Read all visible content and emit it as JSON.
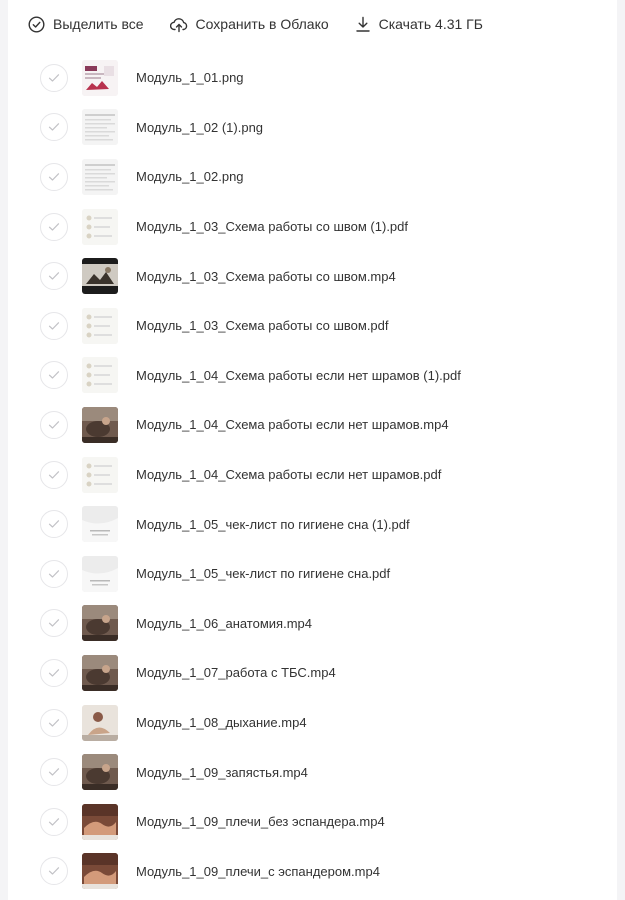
{
  "toolbar": {
    "select_all_label": "Выделить все",
    "save_cloud_label": "Сохранить в Облако",
    "download_label": "Скачать 4.31 ГБ"
  },
  "files": [
    {
      "name": "Модуль_1_01.png",
      "thumb": "slide"
    },
    {
      "name": "Модуль_1_02 (1).png",
      "thumb": "doc"
    },
    {
      "name": "Модуль_1_02.png",
      "thumb": "doc"
    },
    {
      "name": "Модуль_1_03_Схема работы со швом (1).pdf",
      "thumb": "pdf"
    },
    {
      "name": "Модуль_1_03_Схема работы со швом.mp4",
      "thumb": "video-dark"
    },
    {
      "name": "Модуль_1_03_Схема работы со швом.pdf",
      "thumb": "pdf"
    },
    {
      "name": "Модуль_1_04_Схема работы если нет шрамов (1).pdf",
      "thumb": "pdf"
    },
    {
      "name": "Модуль_1_04_Схема работы если нет шрамов.mp4",
      "thumb": "video"
    },
    {
      "name": "Модуль_1_04_Схема работы если нет шрамов.pdf",
      "thumb": "pdf"
    },
    {
      "name": "Модуль_1_05_чек-лист по гигиене сна (1).pdf",
      "thumb": "pdf-light"
    },
    {
      "name": "Модуль_1_05_чек-лист по гигиене сна.pdf",
      "thumb": "pdf-light"
    },
    {
      "name": "Модуль_1_06_анатомия.mp4",
      "thumb": "video"
    },
    {
      "name": "Модуль_1_07_работа с ТБС.mp4",
      "thumb": "video"
    },
    {
      "name": "Модуль_1_08_дыхание.mp4",
      "thumb": "video-light"
    },
    {
      "name": "Модуль_1_09_запястья.mp4",
      "thumb": "video"
    },
    {
      "name": "Модуль_1_09_плечи_без эспандера.mp4",
      "thumb": "video-hands"
    },
    {
      "name": "Модуль_1_09_плечи_с эспандером.mp4",
      "thumb": "video-hands"
    }
  ]
}
